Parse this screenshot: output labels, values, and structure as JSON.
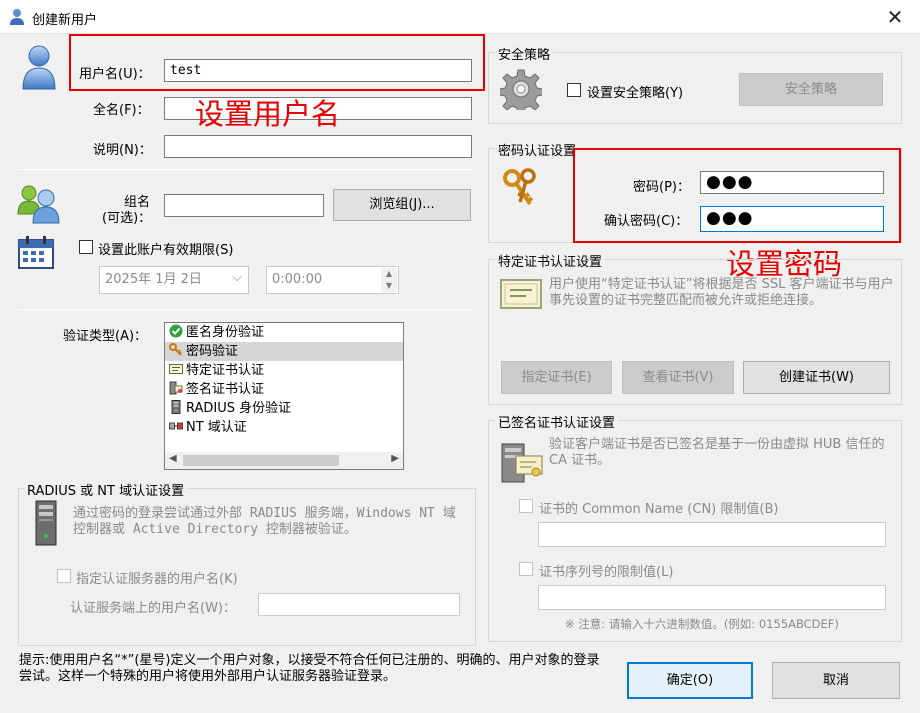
{
  "window": {
    "title": "创建新用户",
    "close_glyph": "✕"
  },
  "user": {
    "username_label": "用户名(U)：",
    "username_value": "test",
    "fullname_label": "全名(F)：",
    "fullname_value": "",
    "desc_label": "说明(N)：",
    "desc_value": ""
  },
  "group": {
    "label_line1": "组名",
    "label_line2": "(可选)：",
    "value": "",
    "browse_button": "浏览组(J)..."
  },
  "expiry": {
    "checkbox_label": "设置此账户有效期限(S)",
    "checked": false,
    "date_value": "2025年  1月  2日",
    "time_value": "0:00:00"
  },
  "auth": {
    "label": "验证类型(A)：",
    "items": [
      {
        "label": "匿名身份验证",
        "icon": "green-check-icon",
        "selected": false
      },
      {
        "label": "密码验证",
        "icon": "keys-icon",
        "selected": true
      },
      {
        "label": "特定证书认证",
        "icon": "certificate-icon",
        "selected": false
      },
      {
        "label": "签名证书认证",
        "icon": "signed-cert-icon",
        "selected": false
      },
      {
        "label": "RADIUS 身份验证",
        "icon": "server-icon",
        "selected": false
      },
      {
        "label": "NT 域认证",
        "icon": "nt-domain-icon",
        "selected": false
      }
    ]
  },
  "radius": {
    "title": "RADIUS 或 NT 域认证设置",
    "description": "通过密码的登录尝试通过外部 RADIUS 服务端，Windows NT 域控制器或 Active Directory 控制器被验证。",
    "specify_label": "指定认证服务器的用户名(K)",
    "server_user_label": "认证服务端上的用户名(W)：",
    "server_user_value": ""
  },
  "security": {
    "title": "安全策略",
    "checkbox_label": "设置安全策略(Y)",
    "button": "安全策略"
  },
  "password": {
    "title": "密码认证设置",
    "pw_label": "密码(P)：",
    "pw_value": "●●●",
    "confirm_label": "确认密码(C)：",
    "confirm_value": "●●●"
  },
  "cert": {
    "title": "特定证书认证设置",
    "description": "用户使用“特定证书认证”将根据是否 SSL 客户端证书与用户事先设置的证书完整匹配而被允许或拒绝连接。",
    "btn_specify": "指定证书(E)",
    "btn_view": "查看证书(V)",
    "btn_create": "创建证书(W)"
  },
  "signed": {
    "title": "已签名证书认证设置",
    "description": "验证客户端证书是否已签名是基于一份由虚拟 HUB 信任的 CA 证书。",
    "cn_label": "证书的 Common Name (CN) 限制值(B)",
    "cn_value": "",
    "serial_label": "证书序列号的限制值(L)",
    "serial_value": "",
    "note": "※ 注意: 请输入十六进制数值。(例如: 0155ABCDEF)"
  },
  "hint": {
    "text": "提示:使用用户名“*”(星号)定义一个用户对象，以接受不符合任何已注册的、明确的、用户对象的登录尝试。这样一个特殊的用户将使用外部用户认证服务器验证登录。"
  },
  "buttons": {
    "ok": "确定(O)",
    "cancel": "取消"
  },
  "annotations": {
    "set_username": "设置用户名",
    "set_password": "设置密码"
  },
  "colors": {
    "annotation_red": "#e60000",
    "focus_blue": "#0078d7",
    "dialog_bg": "#f0f0f0"
  }
}
